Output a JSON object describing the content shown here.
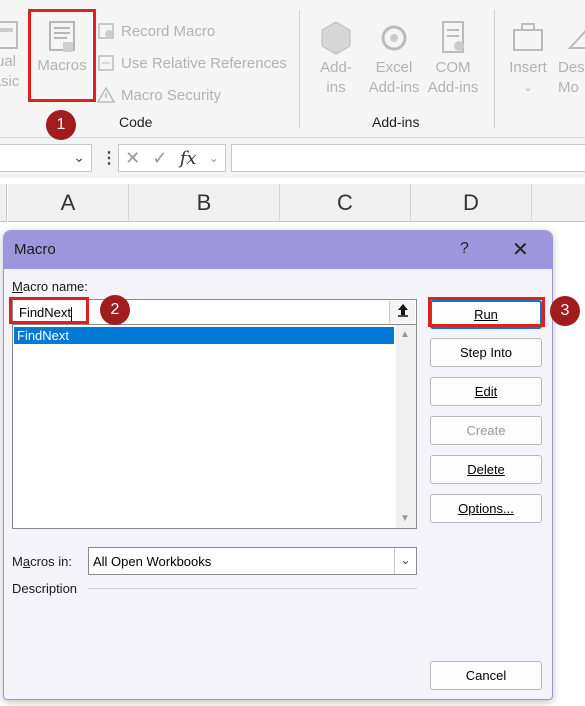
{
  "ribbon": {
    "visual_basic_label": "Visual Basic",
    "macros_label": "Macros",
    "record_macro_label": "Record Macro",
    "relative_refs_label": "Use Relative References",
    "macro_security_label": "Macro Security",
    "code_group_label": "Code",
    "addins_label": "Add-ins",
    "excel_addins_label": "Excel Add-ins",
    "com_addins_label": "COM Add-ins",
    "addins_group_label": "Add-ins",
    "insert_label": "Insert",
    "design_mode_label": "Design Mode"
  },
  "formula_bar": {
    "name_box_value": "",
    "fx_label": "fx",
    "formula_value": ""
  },
  "grid": {
    "columns": [
      "A",
      "B",
      "C",
      "D"
    ]
  },
  "dialog": {
    "title": "Macro",
    "help_label": "?",
    "close_label": "✕",
    "macro_name_label": "Macro name:",
    "macro_name_value": "FindNext",
    "macro_list": [
      "FindNext"
    ],
    "macros_in_label": "Macros in:",
    "macros_in_value": "All Open Workbooks",
    "description_label": "Description",
    "buttons": {
      "run": "Run",
      "step_into": "Step Into",
      "edit": "Edit",
      "create": "Create",
      "delete": "Delete",
      "options": "Options...",
      "cancel": "Cancel"
    }
  },
  "annotations": {
    "badge_1": "1",
    "badge_2": "2",
    "badge_3": "3",
    "highlight_color": "#e0201f",
    "badge_color": "#a11d1d"
  }
}
